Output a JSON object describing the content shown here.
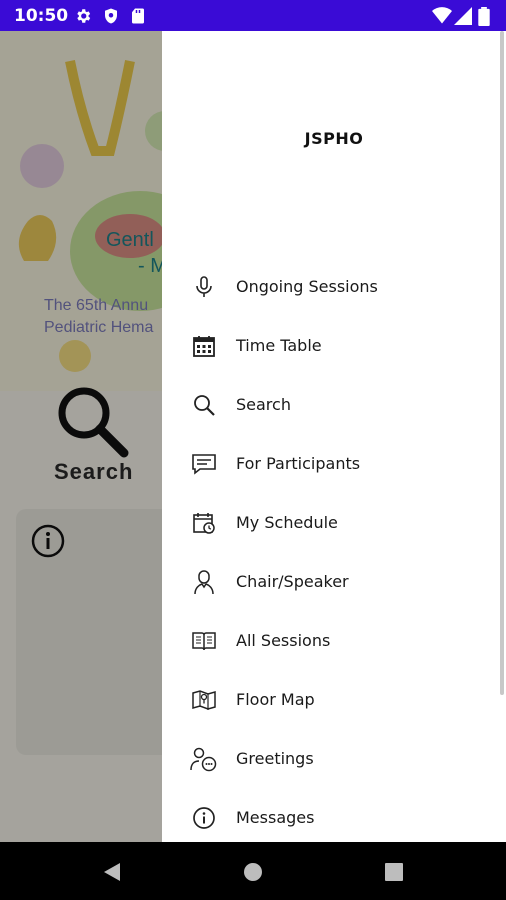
{
  "status_bar": {
    "time": "10:50",
    "icons": [
      "gear-icon",
      "shield-icon",
      "sdcard-icon",
      "wifi-icon",
      "signal-icon",
      "battery-icon"
    ],
    "color": "#3a0bd6"
  },
  "background_app": {
    "banner_lines": [
      "Gentl",
      "- Me",
      "The 65th Annu",
      "Pediatric Hema"
    ],
    "search_label": "Search"
  },
  "drawer": {
    "title": "JSPHO",
    "items": [
      {
        "label": "Ongoing Sessions",
        "icon": "microphone-icon"
      },
      {
        "label": "Time Table",
        "icon": "calendar-icon"
      },
      {
        "label": "Search",
        "icon": "search-icon"
      },
      {
        "label": "For Participants",
        "icon": "chat-icon"
      },
      {
        "label": "My Schedule",
        "icon": "schedule-icon"
      },
      {
        "label": "Chair/Speaker",
        "icon": "person-icon"
      },
      {
        "label": "All Sessions",
        "icon": "book-icon"
      },
      {
        "label": "Floor Map",
        "icon": "map-icon"
      },
      {
        "label": "Greetings",
        "icon": "greeting-icon"
      },
      {
        "label": "Messages",
        "icon": "info-icon"
      }
    ]
  },
  "nav_bar": {
    "buttons": [
      "back-icon",
      "home-icon",
      "recents-icon"
    ]
  }
}
